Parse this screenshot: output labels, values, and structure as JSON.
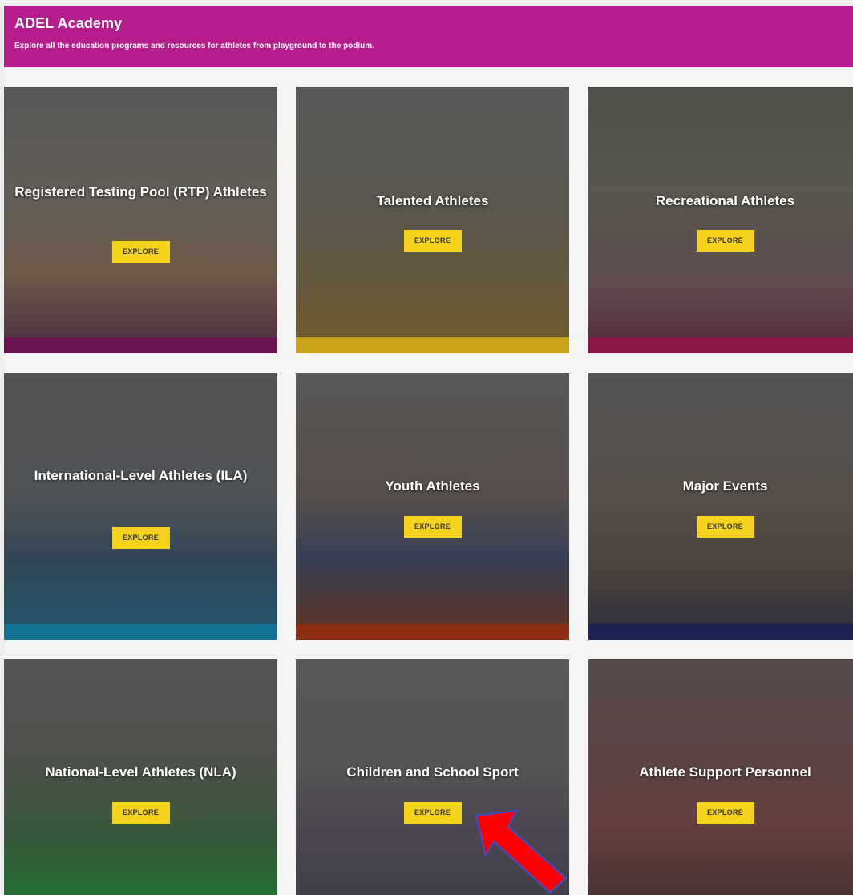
{
  "header": {
    "title": "ADEL Academy",
    "subtitle": "Explore all the education programs and resources for athletes from playground to the podium."
  },
  "colors": {
    "header_bg": "#b51c8c",
    "button_bg": "#f5d21c",
    "annotation_arrow": "#ff0000"
  },
  "tiles": [
    {
      "label": "Registered Testing Pool (RTP) Athletes",
      "button": "EXPLORE",
      "accent": "#6a1150"
    },
    {
      "label": "Talented Athletes",
      "button": "EXPLORE",
      "accent": "#c9a418"
    },
    {
      "label": "Recreational Athletes",
      "button": "EXPLORE",
      "accent": "#8e1848"
    },
    {
      "label": "International-Level Athletes (ILA)",
      "button": "EXPLORE",
      "accent": "#127293"
    },
    {
      "label": "Youth Athletes",
      "button": "EXPLORE",
      "accent": "#8c2d10"
    },
    {
      "label": "Major Events",
      "button": "EXPLORE",
      "accent": "#1c2254"
    },
    {
      "label": "National-Level Athletes (NLA)",
      "button": "EXPLORE",
      "accent": "#23803a"
    },
    {
      "label": "Children and School Sport",
      "button": "EXPLORE",
      "accent": "#444444"
    },
    {
      "label": "Athlete Support Personnel",
      "button": "EXPLORE",
      "accent": "#6b1f28"
    }
  ]
}
